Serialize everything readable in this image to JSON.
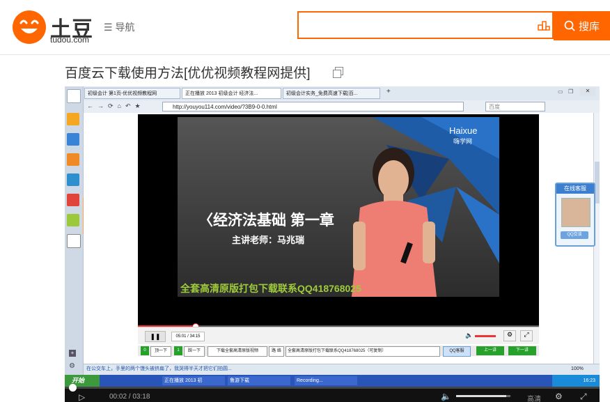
{
  "header": {
    "logo_text": "土豆",
    "logo_sub": "tudou.com",
    "nav_label": "导航",
    "search_button": "搜库",
    "search_placeholder": ""
  },
  "video_title": "百度云下载使用方法[优优视频教程网提供]",
  "browser": {
    "tabs": [
      "初级会计 第1页-优优视频教程网",
      "正在播放 2013 初级会计 经济法...",
      "初级会计实务_免费高速下载|百..."
    ],
    "url": "http://youyou114.com/video/?3B9-0-0.html",
    "search_engine": "百度",
    "status_text": "在公交车上，手里的两个馒头被挤扁了，我哭得半天才把它们拍圆...",
    "zoom": "100%"
  },
  "player": {
    "brand": "Haixue",
    "brand_sub": "嗨学网",
    "slide_title": "〈经济法基础  第一章",
    "teacher": "主讲老师：马兆瑞",
    "watermark": "全套高清原版打包下载联系QQ418768025",
    "time": "05:01 / 34:15",
    "link_bar": [
      "0",
      "顶一下",
      "1",
      "踩一下",
      "下载全套高清原版视频",
      "路 络",
      "全套高清原版打包下载联系QQ418768025（可复制）",
      "QQ客服",
      "上一讲",
      "下一讲"
    ]
  },
  "chat": {
    "title": "在线客服",
    "button": "QQ交谈"
  },
  "taskbar": {
    "start": "开始",
    "items": [
      "正在播放 2013 初",
      "鲁游下载",
      "Recording..."
    ],
    "clock": "16:23"
  },
  "bottom_player": {
    "time": "00:02 / 03:18",
    "quality": "高清"
  }
}
